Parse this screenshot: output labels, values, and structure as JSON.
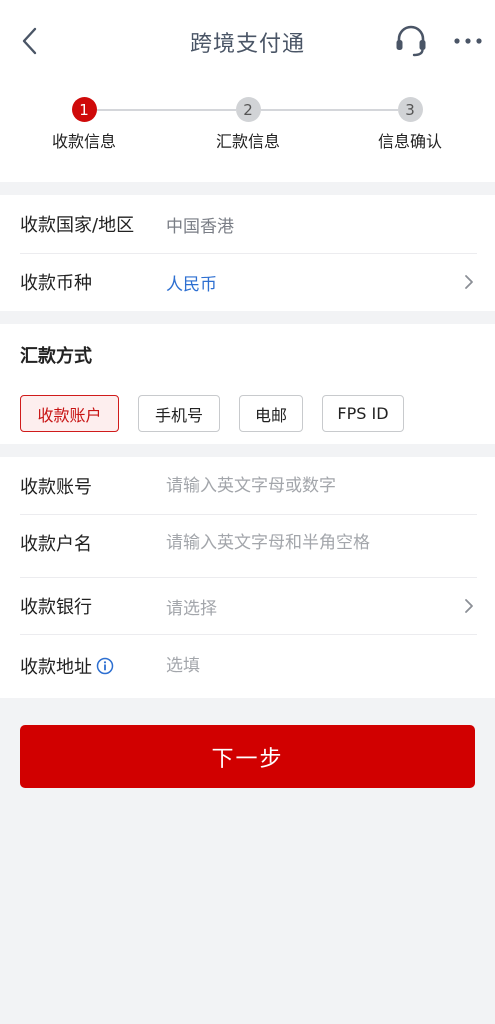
{
  "header": {
    "title": "跨境支付通",
    "back_icon": "chevron-left-icon",
    "support_icon": "headset-icon",
    "more_icon": "more-horizontal-icon"
  },
  "steps": [
    {
      "number": "1",
      "label": "收款信息",
      "active": true
    },
    {
      "number": "2",
      "label": "汇款信息",
      "active": false
    },
    {
      "number": "3",
      "label": "信息确认",
      "active": false
    }
  ],
  "payee_region": {
    "country_label": "收款国家/地区",
    "country_value": "中国香港",
    "currency_label": "收款币种",
    "currency_value": "人民币"
  },
  "remit_method": {
    "title": "汇款方式",
    "options": [
      "收款账户",
      "手机号",
      "电邮",
      "FPS ID"
    ],
    "selected": "收款账户"
  },
  "account_form": {
    "account_no_label": "收款账号",
    "account_no_placeholder": "请输入英文字母或数字",
    "account_name_label": "收款户名",
    "account_name_placeholder": "请输入英文字母和半角空格",
    "bank_label": "收款银行",
    "bank_placeholder": "请选择",
    "address_label": "收款地址",
    "address_placeholder": "选填"
  },
  "next_button": "下一步",
  "colors": {
    "accent_red": "#d10000",
    "link_blue": "#2d6fd1",
    "background": "#f2f3f5"
  }
}
